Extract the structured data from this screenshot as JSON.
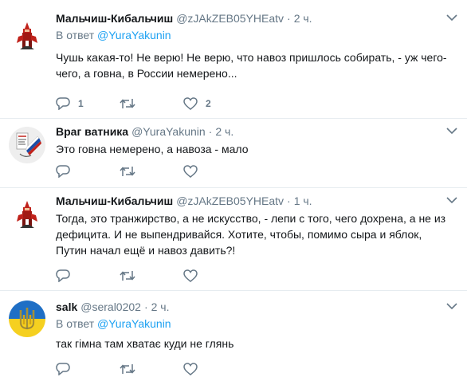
{
  "tweets": [
    {
      "name": "Мальчиш-Кибальчиш",
      "handle": "@zJAkZEB05YHEatv",
      "separator": "·",
      "time": "2 ч.",
      "reply_prefix": "В ответ ",
      "reply_handle": "@YuraYakunin",
      "text": "Чушь какая-то! Не верю! Не верю, что навоз пришлось собирать, - уж чего-чего, а говна, в России  немерено...",
      "reply_count": "1",
      "retweet_count": "",
      "like_count": "2",
      "avatar_icon": "red-horseman-avatar-icon"
    },
    {
      "name": "Враг ватника",
      "handle": "@YuraYakunin",
      "separator": "·",
      "time": "2 ч.",
      "text": "Это говна немерено, а навоза - мало",
      "reply_count": "",
      "retweet_count": "",
      "like_count": "",
      "avatar_icon": "ballot-avatar-icon"
    },
    {
      "name": "Мальчиш-Кибальчиш",
      "handle": "@zJAkZEB05YHEatv",
      "separator": "·",
      "time": "1 ч.",
      "text": "Тогда, это транжирство, а не искусство, - лепи с того, чего дохрена, а не  из дефицита. И не выпендривайся. Хотите, чтобы, помимо сыра и яблок, Путин начал ещё и навоз давить?!",
      "reply_count": "",
      "retweet_count": "",
      "like_count": "",
      "avatar_icon": "red-horseman-avatar-icon"
    },
    {
      "name": "salk",
      "handle": "@seral0202",
      "separator": "·",
      "time": "2 ч.",
      "reply_prefix": "В ответ ",
      "reply_handle": "@YuraYakunin",
      "text": "так гімна там хватає куди не глянь",
      "reply_count": "",
      "retweet_count": "",
      "like_count": "",
      "avatar_icon": "ukraine-trident-avatar-icon"
    }
  ],
  "colors": {
    "text": "#14171a",
    "secondary": "#657786",
    "link": "#1da1f2",
    "divider": "#e6ecf0"
  }
}
